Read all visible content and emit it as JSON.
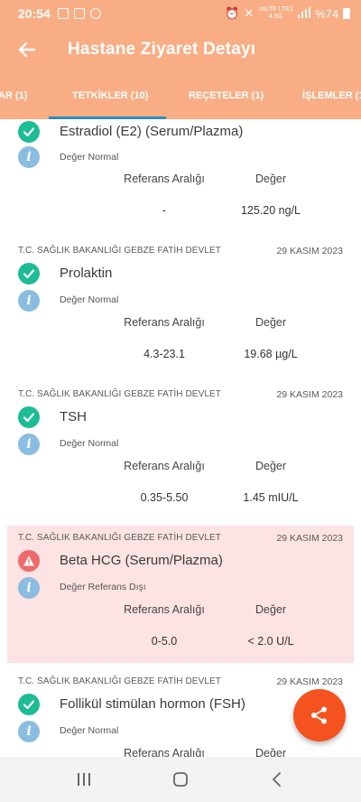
{
  "status_bar": {
    "time": "20:54",
    "network_top": "VoLTE LTE2",
    "network_mid": "4.5G",
    "battery_label": "%74"
  },
  "app": {
    "title": "Hastane Ziyaret Detayı"
  },
  "tabs": [
    {
      "label": "AR (1)"
    },
    {
      "label": "TETKİKLER (10)"
    },
    {
      "label": "REÇETELER (1)"
    },
    {
      "label": "İŞLEMLER (1"
    }
  ],
  "columns": {
    "reference": "Referans Aralığı",
    "value": "Değer"
  },
  "results": [
    {
      "institution": "",
      "date": "",
      "name": "Estradiol (E2) (Serum/Plazma)",
      "status": "normal",
      "note": "Değer Normal",
      "reference": "-",
      "value": "125.20 ng/L"
    },
    {
      "institution": "T.C. SAĞLIK BAKANLIĞI GEBZE FATİH DEVLET",
      "date": "29 KASIM 2023",
      "name": "Prolaktin",
      "status": "normal",
      "note": "Değer Normal",
      "reference": "4.3-23.1",
      "value": "19.68 µg/L"
    },
    {
      "institution": "T.C. SAĞLIK BAKANLIĞI GEBZE FATİH DEVLET",
      "date": "29 KASIM 2023",
      "name": "TSH",
      "status": "normal",
      "note": "Değer Normal",
      "reference": "0.35-5.50",
      "value": "1.45 mIU/L"
    },
    {
      "institution": "T.C. SAĞLIK BAKANLIĞI GEBZE FATİH DEVLET",
      "date": "29 KASIM 2023",
      "name": "Beta HCG (Serum/Plazma)",
      "status": "out_of_range",
      "note": "Değer Referans Dışı",
      "reference": "0-5.0",
      "value": "< 2.0 U/L"
    },
    {
      "institution": "T.C. SAĞLIK BAKANLIĞI GEBZE FATİH DEVLET",
      "date": "29 KASIM 2023",
      "name": "Follikül stimülan hormon (FSH)",
      "status": "normal",
      "note": "Değer Normal",
      "reference": "",
      "value": ""
    }
  ],
  "colors": {
    "header_bg": "#f8ad84",
    "tab_indicator": "#2a8fbf",
    "status_ok": "#1ebc95",
    "status_warn": "#ef6a6a",
    "info": "#8bbde0",
    "alert_bg": "#fde3e3",
    "fab": "#f4521e"
  },
  "icons": {
    "back": "arrow-left-icon",
    "ok": "check-icon",
    "warn": "warning-icon",
    "info": "info-icon",
    "share": "share-icon"
  }
}
